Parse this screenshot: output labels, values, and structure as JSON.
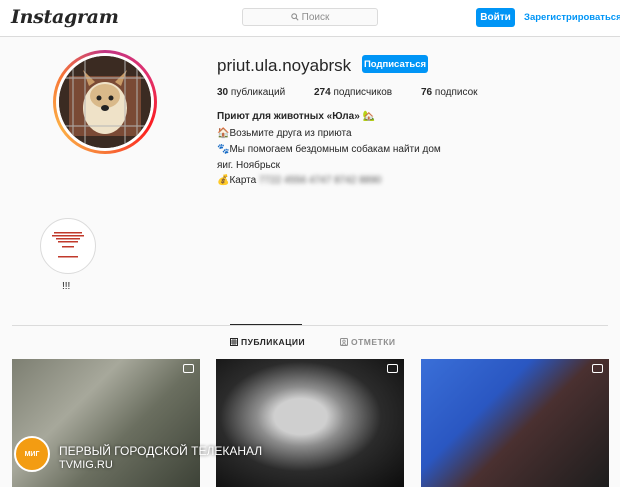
{
  "header": {
    "logo": "Instagram",
    "search_placeholder": "Поиск",
    "login_label": "Войти",
    "signup_label": "Зарегистрироваться"
  },
  "profile": {
    "username": "priut.ula.noyabrsk",
    "follow_label": "Подписаться",
    "stats": {
      "posts_count": "30",
      "posts_label": "публикаций",
      "followers_count": "274",
      "followers_label": "подписчиков",
      "following_count": "76",
      "following_label": "подписок"
    },
    "bio": {
      "name": "Приют для животных «Юла» 🏡",
      "line1": "🏠Возьмите друга из приюта",
      "line2": "🐾Мы помогаем бездомным собакам найти дом",
      "line3": "яиг. Ноябрьск",
      "line4_prefix": "💰Карта",
      "line4_blurred": "7722 4556 4747 8742 8890"
    }
  },
  "highlights": [
    {
      "label": "!!!"
    }
  ],
  "tabs": {
    "posts": "ПУБЛИКАЦИИ",
    "tagged": "ОТМЕТКИ"
  },
  "watermark": {
    "logo_text": "МИГ",
    "title": "ПЕРВЫЙ ГОРОДСКОЙ ТЕЛЕКАНАЛ",
    "url": "TVMIG.RU"
  }
}
